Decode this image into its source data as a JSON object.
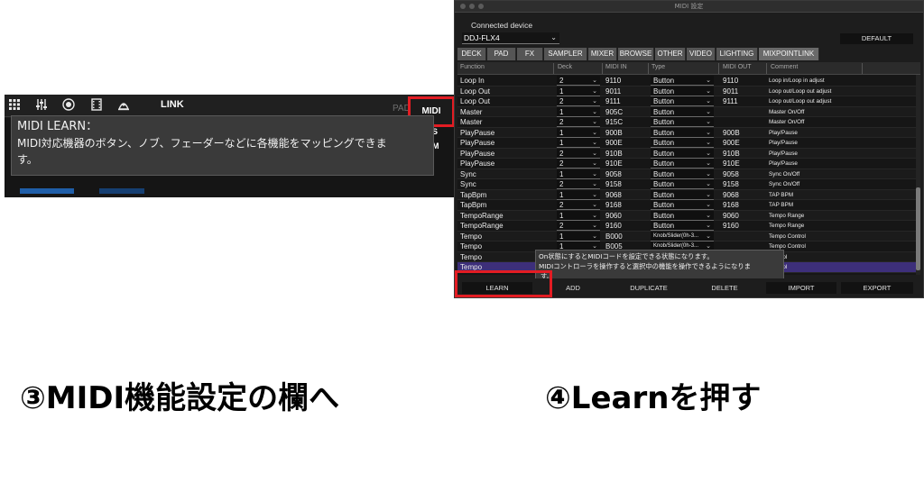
{
  "left": {
    "toolbar": {
      "icons": [
        "grid-icon",
        "mixer-sliders-icon",
        "record-icon",
        "film-icon",
        "sampler-icon"
      ],
      "link_label": "LINK",
      "pad_label": "PAD",
      "midi_label": "MIDI"
    },
    "side_letters": [
      "S",
      "M"
    ],
    "tooltip": {
      "title": "MIDI LEARN：",
      "line1": "MIDI対応機器のボタン、ノブ、フェーダーなどに各機能をマッピングできま",
      "line2": "す。"
    }
  },
  "window": {
    "title": "MIDI 設定",
    "connected_label": "Connected device",
    "device": "DDJ-FLX4",
    "default_label": "DEFAULT",
    "tabs": [
      "DECK",
      "PAD",
      "FX",
      "SAMPLER",
      "MIXER",
      "BROWSE",
      "OTHER",
      "VIDEO",
      "LIGHTING",
      "MIXPOINTLINK"
    ],
    "columns": [
      "Function",
      "Deck",
      "MIDI IN",
      "Type",
      "MIDI OUT",
      "Comment"
    ],
    "rows": [
      {
        "function": "Loop In",
        "deck": "2",
        "midi_in": "9110",
        "type": "Button",
        "midi_out": "9110",
        "comment": "Loop in/Loop in adjust"
      },
      {
        "function": "Loop Out",
        "deck": "1",
        "midi_in": "9011",
        "type": "Button",
        "midi_out": "9011",
        "comment": "Loop out/Loop out adjust"
      },
      {
        "function": "Loop Out",
        "deck": "2",
        "midi_in": "9111",
        "type": "Button",
        "midi_out": "9111",
        "comment": "Loop out/Loop out adjust"
      },
      {
        "function": "Master",
        "deck": "1",
        "midi_in": "905C",
        "type": "Button",
        "midi_out": "",
        "comment": "Master On/Off"
      },
      {
        "function": "Master",
        "deck": "2",
        "midi_in": "915C",
        "type": "Button",
        "midi_out": "",
        "comment": "Master On/Off"
      },
      {
        "function": "PlayPause",
        "deck": "1",
        "midi_in": "900B",
        "type": "Button",
        "midi_out": "900B",
        "comment": "Play/Pause"
      },
      {
        "function": "PlayPause",
        "deck": "1",
        "midi_in": "900E",
        "type": "Button",
        "midi_out": "900E",
        "comment": "Play/Pause"
      },
      {
        "function": "PlayPause",
        "deck": "2",
        "midi_in": "910B",
        "type": "Button",
        "midi_out": "910B",
        "comment": "Play/Pause"
      },
      {
        "function": "PlayPause",
        "deck": "2",
        "midi_in": "910E",
        "type": "Button",
        "midi_out": "910E",
        "comment": "Play/Pause"
      },
      {
        "function": "Sync",
        "deck": "1",
        "midi_in": "9058",
        "type": "Button",
        "midi_out": "9058",
        "comment": "Sync On/Off"
      },
      {
        "function": "Sync",
        "deck": "2",
        "midi_in": "9158",
        "type": "Button",
        "midi_out": "9158",
        "comment": "Sync On/Off"
      },
      {
        "function": "TapBpm",
        "deck": "1",
        "midi_in": "9068",
        "type": "Button",
        "midi_out": "9068",
        "comment": "TAP BPM"
      },
      {
        "function": "TapBpm",
        "deck": "2",
        "midi_in": "9168",
        "type": "Button",
        "midi_out": "9168",
        "comment": "TAP BPM"
      },
      {
        "function": "TempoRange",
        "deck": "1",
        "midi_in": "9060",
        "type": "Button",
        "midi_out": "9060",
        "comment": "Tempo Range"
      },
      {
        "function": "TempoRange",
        "deck": "2",
        "midi_in": "9160",
        "type": "Button",
        "midi_out": "9160",
        "comment": "Tempo Range"
      },
      {
        "function": "Tempo",
        "deck": "1",
        "midi_in": "B000",
        "type": "Knob/Slider(0h-3...",
        "midi_out": "",
        "comment": "Tempo Control"
      },
      {
        "function": "Tempo",
        "deck": "1",
        "midi_in": "B005",
        "type": "Knob/Slider(0h-3...",
        "midi_out": "",
        "comment": "Tempo Control"
      },
      {
        "function": "Tempo",
        "deck": "",
        "midi_in": "",
        "type": "",
        "midi_out": "",
        "comment": "Control"
      },
      {
        "function": "Tempo",
        "deck": "",
        "midi_in": "",
        "type": "",
        "midi_out": "",
        "comment": "Control"
      }
    ],
    "tooltip": {
      "line1": "On状態にするとMIDIコードを設定できる状態になります。",
      "line2": "MIDIコントローラを操作すると選択中の機能を操作できるようになりま",
      "line3": "す。"
    },
    "buttons": {
      "learn": "LEARN",
      "add": "ADD",
      "duplicate": "DUPLICATE",
      "delete": "DELETE",
      "import": "IMPORT",
      "export": "EXPORT"
    }
  },
  "captions": {
    "step3": "③MIDI機能設定の欄へ",
    "step4": "④Learnを押す"
  },
  "colors": {
    "highlight_red": "#e31c23",
    "selected_row": "#3d2f7a",
    "panel_bg": "#1d1d1d"
  }
}
